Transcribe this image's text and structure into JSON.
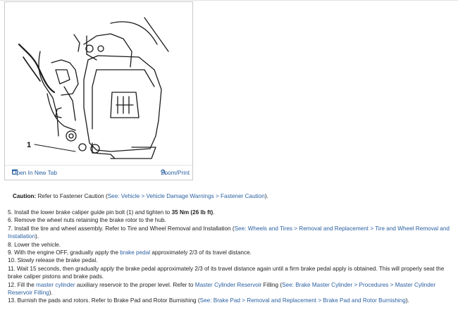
{
  "figure": {
    "callout": "1",
    "open_label": "Open In New Tab",
    "zoom_label": "Zoom/Print",
    "open_icon": "open-in-new-tab-icon",
    "zoom_icon": "magnifier-icon"
  },
  "caution": {
    "label": "Caution:",
    "text_before": " Refer to Fastener Caution (",
    "link": "See: Vehicle > Vehicle Damage Warnings > Fastener Caution",
    "text_after": ")."
  },
  "steps": {
    "s5": {
      "a": "5. Install the lower brake caliper guide pin bolt (1) and tighten to ",
      "b": "35 Nm (26 lb ft)",
      "c": "."
    },
    "s6": {
      "a": "6. Remove the wheel nuts retaining the brake rotor to the hub."
    },
    "s7": {
      "a": "7. Install the tire and wheel assembly. Refer to Tire and Wheel Removal and Installation (",
      "link": "See: Wheels and Tires > Removal and Replacement > Tire and Wheel Removal and Installation",
      "c": ")."
    },
    "s8": {
      "a": "8. Lower the vehicle."
    },
    "s9": {
      "a": "9. With the engine OFF, gradually apply the ",
      "link": "brake pedal",
      "c": " approximately 2/3 of its travel distance."
    },
    "s10": {
      "a": "10. Slowly release the brake pedal."
    },
    "s11": {
      "a": "11. Wait 15 seconds, then gradually apply the brake pedal approximately 2/3 of its travel distance again until a firm brake pedal apply is obtained. This will properly seat the brake caliper pistons and brake pads."
    },
    "s12": {
      "a": "12. Fill the ",
      "link1": "master cylinder",
      "b": " auxiliary reservoir to the proper level. Refer to ",
      "link2": "Master Cylinder Reservoir",
      "c": " Filling (",
      "link3": "See: Brake Master Cylinder > Procedures > Master Cylinder Reservoir Filling",
      "d": ")."
    },
    "s13": {
      "a": "13. Burnish the pads and rotors. Refer to Brake Pad and Rotor Burnishing (",
      "link": "See: Brake Pad > Removal and Replacement > Brake Pad and Rotor Burnishing",
      "c": ")."
    }
  }
}
